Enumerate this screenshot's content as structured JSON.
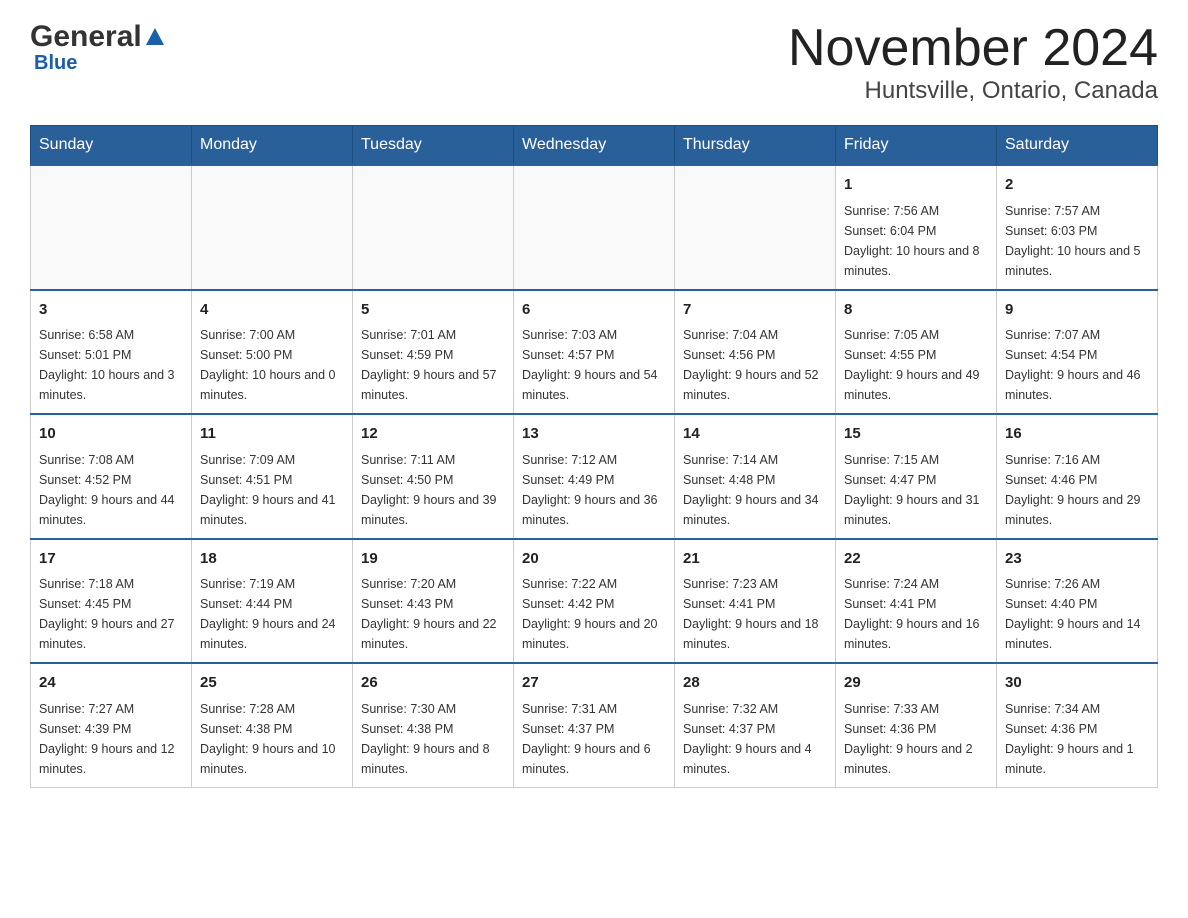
{
  "logo": {
    "general": "General",
    "blue": "Blue"
  },
  "title": {
    "month_year": "November 2024",
    "location": "Huntsville, Ontario, Canada"
  },
  "days_of_week": [
    "Sunday",
    "Monday",
    "Tuesday",
    "Wednesday",
    "Thursday",
    "Friday",
    "Saturday"
  ],
  "weeks": [
    [
      {
        "day": "",
        "info": ""
      },
      {
        "day": "",
        "info": ""
      },
      {
        "day": "",
        "info": ""
      },
      {
        "day": "",
        "info": ""
      },
      {
        "day": "",
        "info": ""
      },
      {
        "day": "1",
        "info": "Sunrise: 7:56 AM\nSunset: 6:04 PM\nDaylight: 10 hours and 8 minutes."
      },
      {
        "day": "2",
        "info": "Sunrise: 7:57 AM\nSunset: 6:03 PM\nDaylight: 10 hours and 5 minutes."
      }
    ],
    [
      {
        "day": "3",
        "info": "Sunrise: 6:58 AM\nSunset: 5:01 PM\nDaylight: 10 hours and 3 minutes."
      },
      {
        "day": "4",
        "info": "Sunrise: 7:00 AM\nSunset: 5:00 PM\nDaylight: 10 hours and 0 minutes."
      },
      {
        "day": "5",
        "info": "Sunrise: 7:01 AM\nSunset: 4:59 PM\nDaylight: 9 hours and 57 minutes."
      },
      {
        "day": "6",
        "info": "Sunrise: 7:03 AM\nSunset: 4:57 PM\nDaylight: 9 hours and 54 minutes."
      },
      {
        "day": "7",
        "info": "Sunrise: 7:04 AM\nSunset: 4:56 PM\nDaylight: 9 hours and 52 minutes."
      },
      {
        "day": "8",
        "info": "Sunrise: 7:05 AM\nSunset: 4:55 PM\nDaylight: 9 hours and 49 minutes."
      },
      {
        "day": "9",
        "info": "Sunrise: 7:07 AM\nSunset: 4:54 PM\nDaylight: 9 hours and 46 minutes."
      }
    ],
    [
      {
        "day": "10",
        "info": "Sunrise: 7:08 AM\nSunset: 4:52 PM\nDaylight: 9 hours and 44 minutes."
      },
      {
        "day": "11",
        "info": "Sunrise: 7:09 AM\nSunset: 4:51 PM\nDaylight: 9 hours and 41 minutes."
      },
      {
        "day": "12",
        "info": "Sunrise: 7:11 AM\nSunset: 4:50 PM\nDaylight: 9 hours and 39 minutes."
      },
      {
        "day": "13",
        "info": "Sunrise: 7:12 AM\nSunset: 4:49 PM\nDaylight: 9 hours and 36 minutes."
      },
      {
        "day": "14",
        "info": "Sunrise: 7:14 AM\nSunset: 4:48 PM\nDaylight: 9 hours and 34 minutes."
      },
      {
        "day": "15",
        "info": "Sunrise: 7:15 AM\nSunset: 4:47 PM\nDaylight: 9 hours and 31 minutes."
      },
      {
        "day": "16",
        "info": "Sunrise: 7:16 AM\nSunset: 4:46 PM\nDaylight: 9 hours and 29 minutes."
      }
    ],
    [
      {
        "day": "17",
        "info": "Sunrise: 7:18 AM\nSunset: 4:45 PM\nDaylight: 9 hours and 27 minutes."
      },
      {
        "day": "18",
        "info": "Sunrise: 7:19 AM\nSunset: 4:44 PM\nDaylight: 9 hours and 24 minutes."
      },
      {
        "day": "19",
        "info": "Sunrise: 7:20 AM\nSunset: 4:43 PM\nDaylight: 9 hours and 22 minutes."
      },
      {
        "day": "20",
        "info": "Sunrise: 7:22 AM\nSunset: 4:42 PM\nDaylight: 9 hours and 20 minutes."
      },
      {
        "day": "21",
        "info": "Sunrise: 7:23 AM\nSunset: 4:41 PM\nDaylight: 9 hours and 18 minutes."
      },
      {
        "day": "22",
        "info": "Sunrise: 7:24 AM\nSunset: 4:41 PM\nDaylight: 9 hours and 16 minutes."
      },
      {
        "day": "23",
        "info": "Sunrise: 7:26 AM\nSunset: 4:40 PM\nDaylight: 9 hours and 14 minutes."
      }
    ],
    [
      {
        "day": "24",
        "info": "Sunrise: 7:27 AM\nSunset: 4:39 PM\nDaylight: 9 hours and 12 minutes."
      },
      {
        "day": "25",
        "info": "Sunrise: 7:28 AM\nSunset: 4:38 PM\nDaylight: 9 hours and 10 minutes."
      },
      {
        "day": "26",
        "info": "Sunrise: 7:30 AM\nSunset: 4:38 PM\nDaylight: 9 hours and 8 minutes."
      },
      {
        "day": "27",
        "info": "Sunrise: 7:31 AM\nSunset: 4:37 PM\nDaylight: 9 hours and 6 minutes."
      },
      {
        "day": "28",
        "info": "Sunrise: 7:32 AM\nSunset: 4:37 PM\nDaylight: 9 hours and 4 minutes."
      },
      {
        "day": "29",
        "info": "Sunrise: 7:33 AM\nSunset: 4:36 PM\nDaylight: 9 hours and 2 minutes."
      },
      {
        "day": "30",
        "info": "Sunrise: 7:34 AM\nSunset: 4:36 PM\nDaylight: 9 hours and 1 minute."
      }
    ]
  ]
}
